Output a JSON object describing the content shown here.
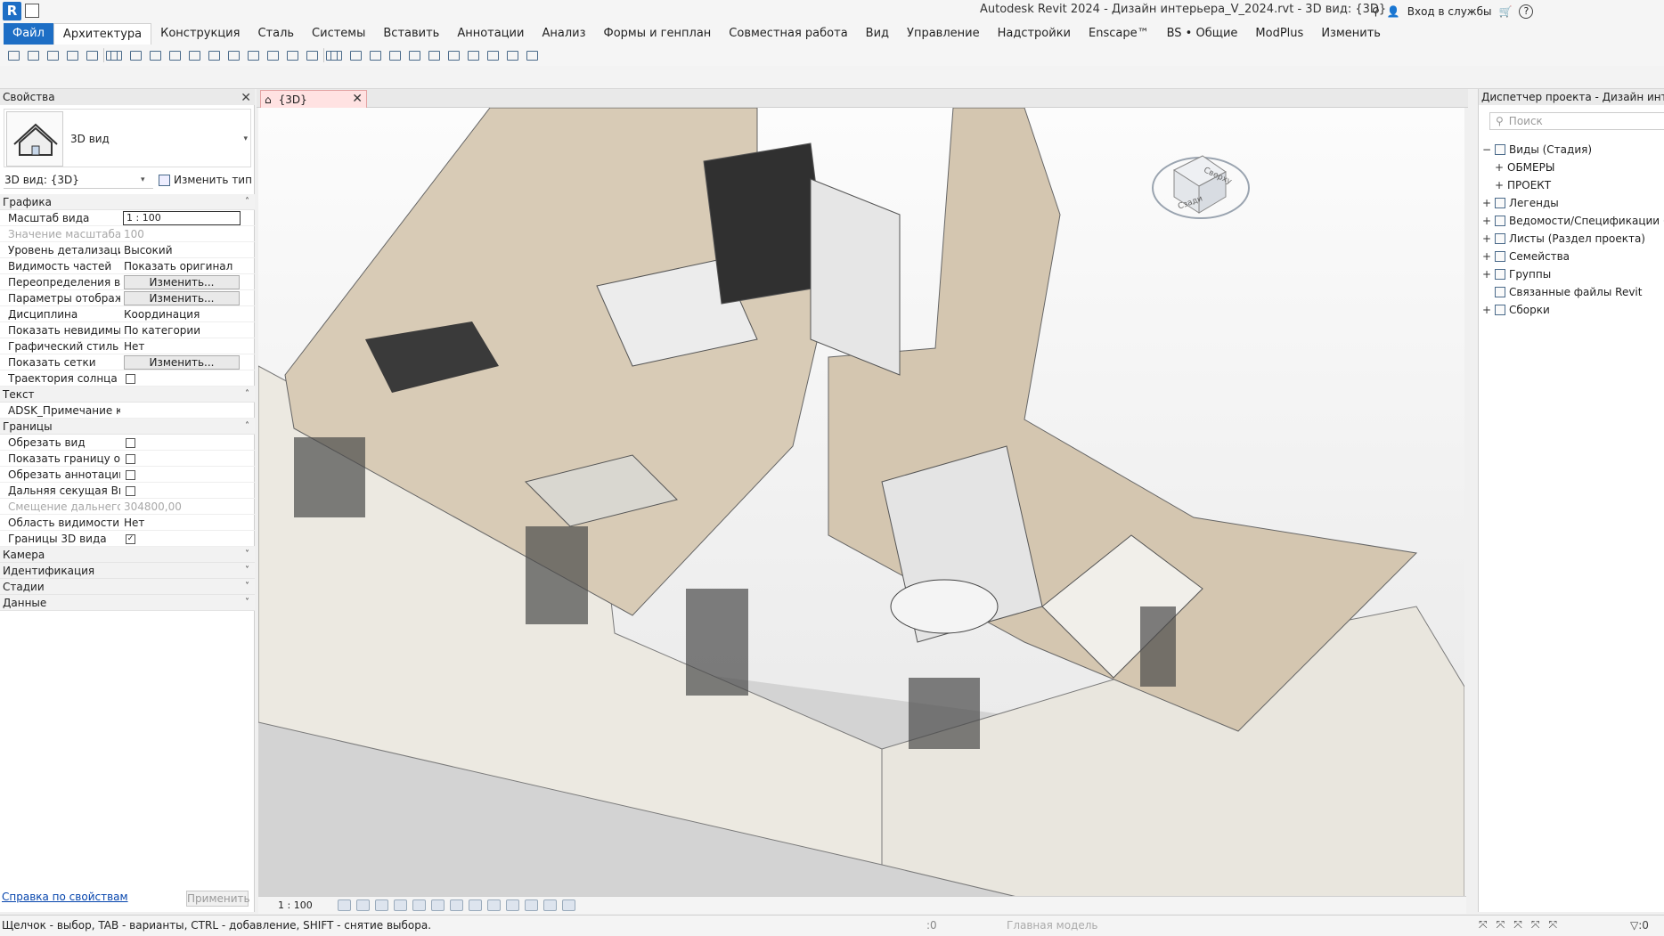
{
  "title": "Autodesk Revit 2024 - Дизайн интерьера_V_2024.rvt - 3D вид: {3D}",
  "app_logo": "R",
  "topbar": {
    "login": "Вход в службы",
    "help": "?"
  },
  "ribbon_tabs": [
    {
      "label": "Файл",
      "kind": "file"
    },
    {
      "label": "Архитектура",
      "kind": "active"
    },
    {
      "label": "Конструкция",
      "kind": ""
    },
    {
      "label": "Сталь",
      "kind": ""
    },
    {
      "label": "Системы",
      "kind": ""
    },
    {
      "label": "Вставить",
      "kind": ""
    },
    {
      "label": "Аннотации",
      "kind": ""
    },
    {
      "label": "Анализ",
      "kind": ""
    },
    {
      "label": "Формы и генплан",
      "kind": ""
    },
    {
      "label": "Совместная работа",
      "kind": ""
    },
    {
      "label": "Вид",
      "kind": ""
    },
    {
      "label": "Управление",
      "kind": ""
    },
    {
      "label": "Надстройки",
      "kind": ""
    },
    {
      "label": "Enscape™",
      "kind": ""
    },
    {
      "label": "BS • Общие",
      "kind": ""
    },
    {
      "label": "ModPlus",
      "kind": ""
    },
    {
      "label": "Изменить",
      "kind": ""
    }
  ],
  "properties": {
    "header": "Свойства",
    "type_name": "3D вид",
    "view_selector": "3D вид: {3D}",
    "edit_type": "Изменить тип",
    "sections": [
      {
        "title": "Графика",
        "collapse": "˄",
        "rows": [
          {
            "key": "Масштаб вида",
            "value": "1 : 100",
            "kind": "input"
          },
          {
            "key": "Значение масштаба ...",
            "value": "100",
            "kind": "dim"
          },
          {
            "key": "Уровень детализации",
            "value": "Высокий",
            "kind": "text"
          },
          {
            "key": "Видимость частей",
            "value": "Показать оригинал",
            "kind": "text"
          },
          {
            "key": "Переопределения ви...",
            "value": "Изменить...",
            "kind": "button"
          },
          {
            "key": "Параметры отображ...",
            "value": "Изменить...",
            "kind": "button"
          },
          {
            "key": "Дисциплина",
            "value": "Координация",
            "kind": "text"
          },
          {
            "key": "Показать невидимые...",
            "value": "По категории",
            "kind": "text"
          },
          {
            "key": "Графический стиль ...",
            "value": "Нет",
            "kind": "text"
          },
          {
            "key": "Показать сетки",
            "value": "Изменить...",
            "kind": "button"
          },
          {
            "key": "Траектория солнца",
            "value": "",
            "kind": "checkbox",
            "checked": false
          }
        ]
      },
      {
        "title": "Текст",
        "collapse": "˄",
        "rows": [
          {
            "key": "ADSK_Примечание к ...",
            "value": "",
            "kind": "text"
          }
        ]
      },
      {
        "title": "Границы",
        "collapse": "˄",
        "rows": [
          {
            "key": "Обрезать вид",
            "value": "",
            "kind": "checkbox",
            "checked": false
          },
          {
            "key": "Показать границу об...",
            "value": "",
            "kind": "checkbox",
            "checked": false
          },
          {
            "key": "Обрезать аннотации",
            "value": "",
            "kind": "checkbox",
            "checked": false
          },
          {
            "key": "Дальняя секущая Вкл",
            "value": "",
            "kind": "checkbox",
            "checked": false
          },
          {
            "key": "Смещение дальнего ...",
            "value": "304800,00",
            "kind": "dim"
          },
          {
            "key": "Область видимости",
            "value": "Нет",
            "kind": "text"
          },
          {
            "key": "Границы 3D вида",
            "value": "",
            "kind": "checkbox",
            "checked": true
          }
        ]
      },
      {
        "title": "Камера",
        "collapse": "˅",
        "rows": []
      },
      {
        "title": "Идентификация",
        "collapse": "˅",
        "rows": []
      },
      {
        "title": "Стадии",
        "collapse": "˅",
        "rows": []
      },
      {
        "title": "Данные",
        "collapse": "˅",
        "rows": []
      }
    ],
    "help_link": "Справка по свойствам",
    "apply": "Применить"
  },
  "view": {
    "tab_label": "{3D}",
    "viewcube_top": "Сверху",
    "viewcube_front": "Сзади",
    "scale": "1 : 100"
  },
  "browser": {
    "header": "Диспетчер проекта - Дизайн интерье",
    "search_placeholder": "Поиск",
    "tree": [
      {
        "label": "Виды (Стадия)",
        "level": 0,
        "toggle": "−",
        "icon": true
      },
      {
        "label": "ОБМЕРЫ",
        "level": 1,
        "toggle": "+",
        "icon": false
      },
      {
        "label": "ПРОЕКТ",
        "level": 1,
        "toggle": "+",
        "icon": false
      },
      {
        "label": "Легенды",
        "level": 0,
        "toggle": "+",
        "icon": true
      },
      {
        "label": "Ведомости/Спецификации (Ст",
        "level": 0,
        "toggle": "+",
        "icon": true
      },
      {
        "label": "Листы (Раздел проекта)",
        "level": 0,
        "toggle": "+",
        "icon": true
      },
      {
        "label": "Семейства",
        "level": 0,
        "toggle": "+",
        "icon": true
      },
      {
        "label": "Группы",
        "level": 0,
        "toggle": "+",
        "icon": true
      },
      {
        "label": "Связанные файлы Revit",
        "level": 0,
        "toggle": "",
        "icon": true
      },
      {
        "label": "Сборки",
        "level": 0,
        "toggle": "+",
        "icon": true
      }
    ]
  },
  "status": {
    "hint": "Щелчок - выбор, TAB - варианты, CTRL - добавление, SHIFT - снятие выбора.",
    "zero": ":0",
    "model": "Главная модель",
    "filter": ":0"
  },
  "colors": {
    "accent": "#1d6ec5",
    "tab_active_view": "#ffe2e2",
    "wall": "#ece9e1",
    "floor": "#d8cbb6"
  }
}
